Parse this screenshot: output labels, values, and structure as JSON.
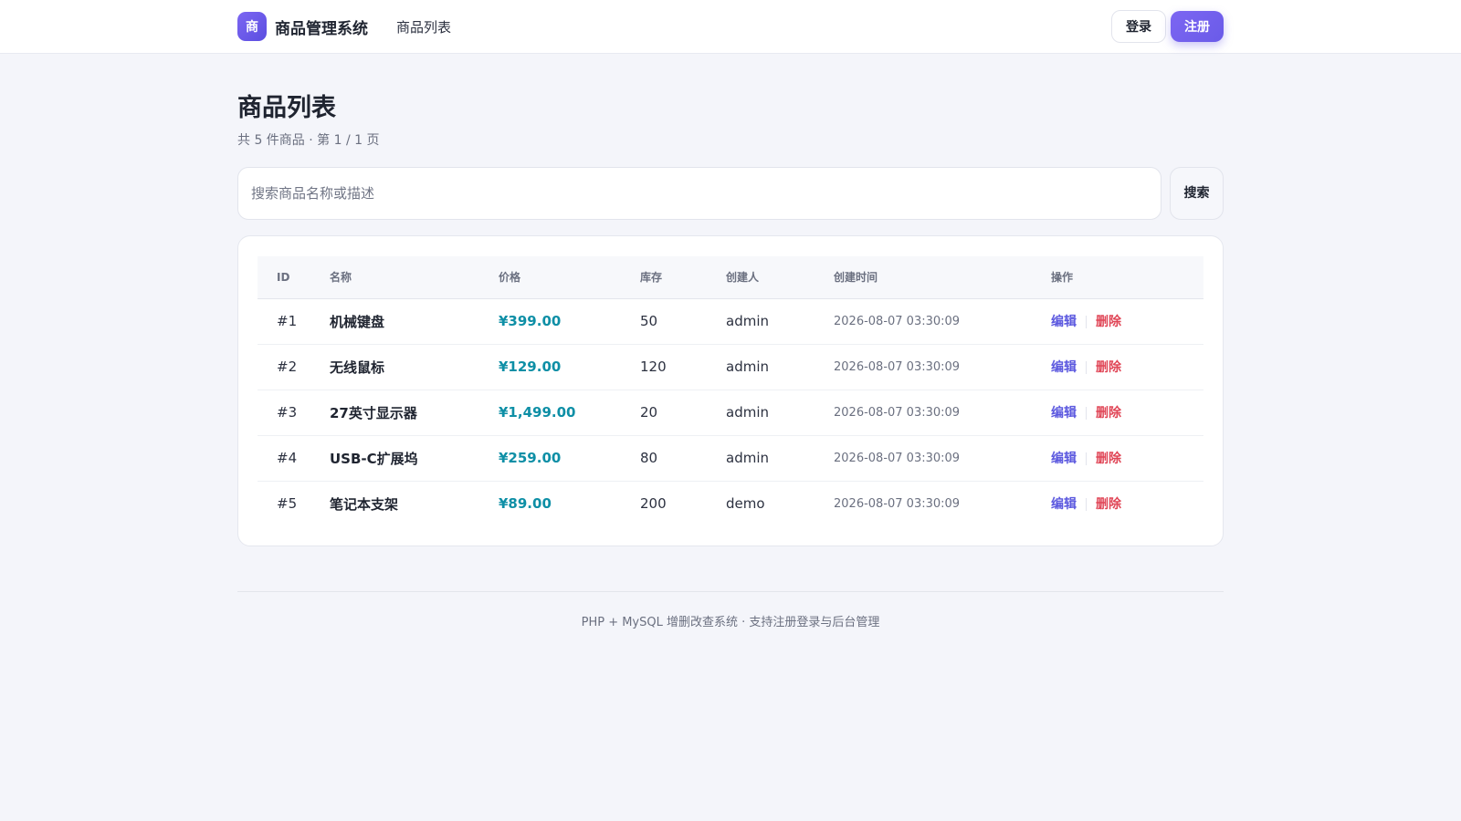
{
  "header": {
    "logo_char": "商",
    "brand": "商品管理系统",
    "nav_link": "商品列表",
    "login_label": "登录",
    "register_label": "注册"
  },
  "page": {
    "title": "商品列表",
    "subtitle": "共 5 件商品 · 第 1 / 1 页"
  },
  "search": {
    "placeholder": "搜索商品名称或描述",
    "value": "",
    "button_label": "搜索"
  },
  "table": {
    "headers": [
      "ID",
      "名称",
      "价格",
      "库存",
      "创建人",
      "创建时间",
      "操作"
    ],
    "edit_label": "编辑",
    "delete_label": "删除",
    "rows": [
      {
        "id": "#1",
        "name": "机械键盘",
        "price": "¥399.00",
        "stock": "50",
        "creator": "admin",
        "created": "2026-08-07 03:30:09"
      },
      {
        "id": "#2",
        "name": "无线鼠标",
        "price": "¥129.00",
        "stock": "120",
        "creator": "admin",
        "created": "2026-08-07 03:30:09"
      },
      {
        "id": "#3",
        "name": "27英寸显示器",
        "price": "¥1,499.00",
        "stock": "20",
        "creator": "admin",
        "created": "2026-08-07 03:30:09"
      },
      {
        "id": "#4",
        "name": "USB-C扩展坞",
        "price": "¥259.00",
        "stock": "80",
        "creator": "admin",
        "created": "2026-08-07 03:30:09"
      },
      {
        "id": "#5",
        "name": "笔记本支架",
        "price": "¥89.00",
        "stock": "200",
        "creator": "demo",
        "created": "2026-08-07 03:30:09"
      }
    ]
  },
  "footer": {
    "text": "PHP + MySQL 增删改查系统 · 支持注册登录与后台管理"
  },
  "colors": {
    "accent": "#6a5be8",
    "price": "#0e8fa6",
    "danger": "#e04556",
    "edit": "#5b58df"
  }
}
